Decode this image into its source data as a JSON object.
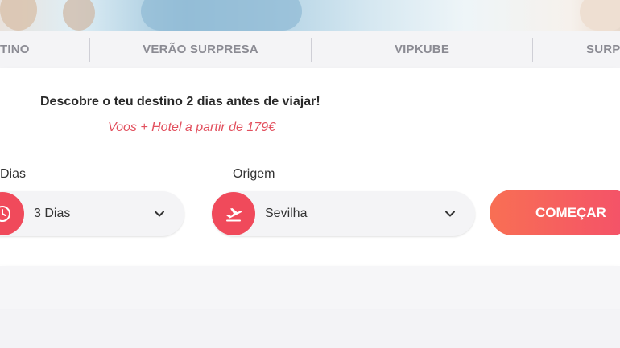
{
  "tabs": [
    {
      "label": "TINO"
    },
    {
      "label": "VERÃO SURPRESA"
    },
    {
      "label": "VIPKUBE"
    },
    {
      "label": "SURP"
    }
  ],
  "card": {
    "headline": "Descobre o teu destino 2 dias antes de viajar!",
    "subline": "Voos + Hotel a partir de 179€",
    "days": {
      "label": "Dias",
      "value": "3 Dias",
      "icon": "clock-icon"
    },
    "origin": {
      "label": "Origem",
      "value": "Sevilha",
      "icon": "plane-takeoff-icon"
    },
    "cta_label": "COMEÇAR"
  },
  "colors": {
    "accent": "#f04a5b",
    "cta_start": "#f86f54",
    "cta_end": "#f4506a",
    "subline": "#e2505e",
    "tab_text": "#8b8b93"
  }
}
